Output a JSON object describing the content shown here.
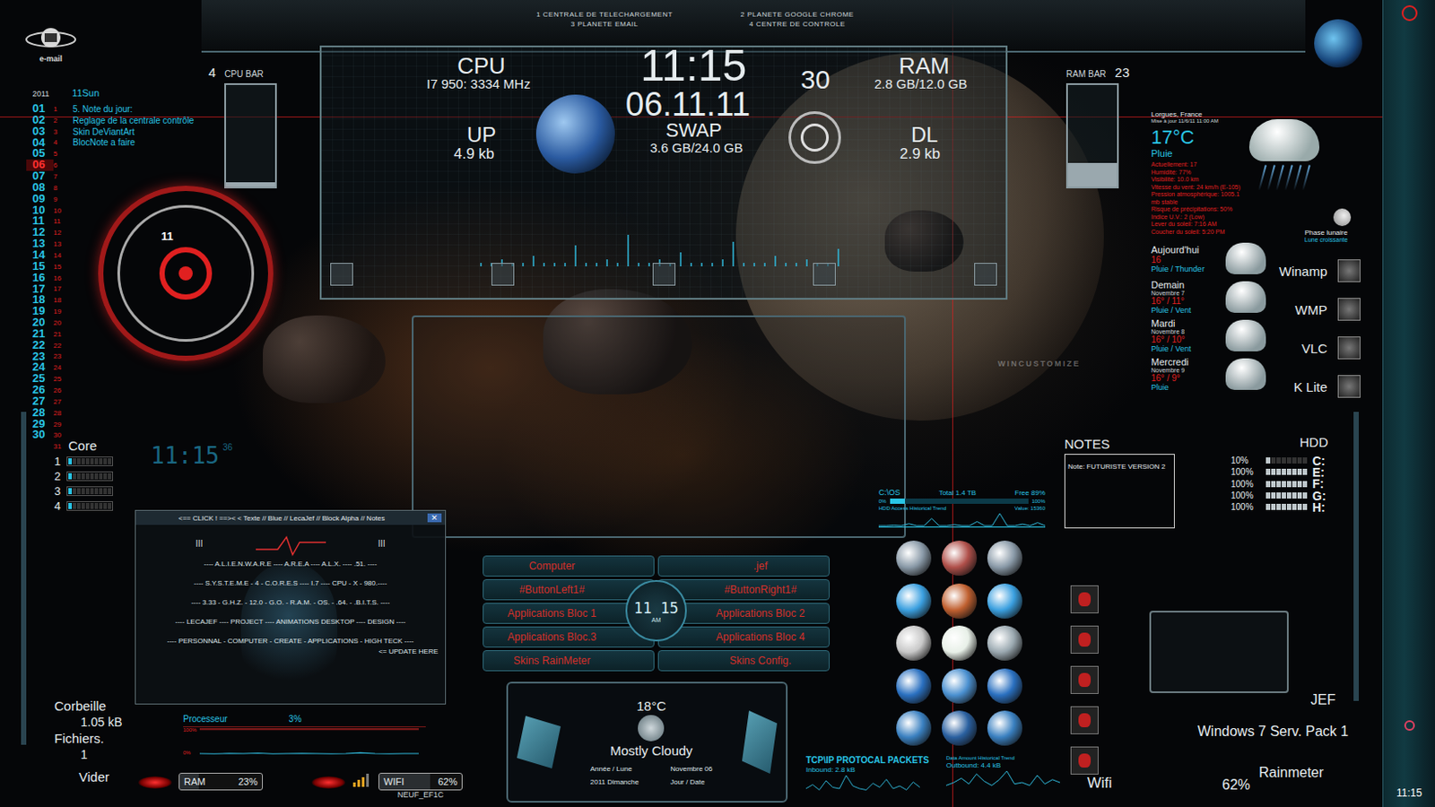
{
  "top_menu": [
    "1 CENTRALE DE TELECHARGEMENT",
    "2 PLANETE GOOGLE CHROME",
    "3 PLANETE EMAIL",
    "4 CENTRE DE CONTROLE"
  ],
  "email_logo": "e-mail",
  "hud": {
    "cpu_label": "CPU",
    "cpu_info": "I7 950: 3334 MHz",
    "time": "11:15",
    "seconds": "30",
    "date": "06.11.11",
    "ram_label": "RAM",
    "ram_info": "2.8 GB/12.0 GB",
    "up_label": "UP",
    "up_value": "4.9 kb",
    "swap_label": "SWAP",
    "swap_value": "3.6 GB/24.0 GB",
    "dl_label": "DL",
    "dl_value": "2.9 kb",
    "traffic_series": [
      1,
      1,
      2,
      1,
      1,
      3,
      1,
      1,
      1,
      6,
      1,
      1,
      2,
      1,
      9,
      1,
      1,
      2,
      1,
      4,
      1,
      1,
      1,
      2,
      7,
      1,
      1,
      1,
      3,
      1,
      1,
      2,
      1,
      1,
      5,
      1
    ]
  },
  "cpu_bar": {
    "label": "CPU BAR",
    "value": "4",
    "level": 0.04
  },
  "ram_bar": {
    "label": "RAM BAR",
    "value": "23",
    "level": 0.23
  },
  "calendar": {
    "year": "2011",
    "today": "11Sun",
    "days": [
      {
        "day": "01",
        "selected": false
      },
      {
        "day": "02",
        "selected": false
      },
      {
        "day": "03",
        "selected": false
      },
      {
        "day": "04",
        "selected": false
      },
      {
        "day": "05",
        "selected": false
      },
      {
        "day": "06",
        "selected": true
      },
      {
        "day": "07",
        "selected": false
      },
      {
        "day": "08",
        "selected": false
      },
      {
        "day": "09",
        "selected": false
      },
      {
        "day": "10",
        "selected": false
      },
      {
        "day": "11",
        "selected": false
      },
      {
        "day": "12",
        "selected": false
      },
      {
        "day": "13",
        "selected": false
      },
      {
        "day": "14",
        "selected": false
      },
      {
        "day": "15",
        "selected": false
      },
      {
        "day": "16",
        "selected": false
      },
      {
        "day": "17",
        "selected": false
      },
      {
        "day": "18",
        "selected": false
      },
      {
        "day": "19",
        "selected": false
      },
      {
        "day": "20",
        "selected": false
      },
      {
        "day": "21",
        "selected": false
      },
      {
        "day": "22",
        "selected": false
      },
      {
        "day": "23",
        "selected": false
      },
      {
        "day": "24",
        "selected": false
      },
      {
        "day": "25",
        "selected": false
      },
      {
        "day": "26",
        "selected": false
      },
      {
        "day": "27",
        "selected": false
      },
      {
        "day": "28",
        "selected": false
      },
      {
        "day": "29",
        "selected": false
      },
      {
        "day": "30",
        "selected": false
      }
    ],
    "lines": [
      "1",
      "2",
      "3",
      "4",
      "5",
      "6",
      "7",
      "8",
      "9",
      "10",
      "11",
      "12",
      "13",
      "14",
      "15",
      "16",
      "17",
      "18",
      "19",
      "20",
      "21",
      "22",
      "23",
      "24",
      "25",
      "26",
      "27",
      "28",
      "29",
      "30",
      "31"
    ]
  },
  "note": {
    "title": "5. Note du jour:",
    "items": [
      "Reglage de la centrale contrôle",
      "Skin DeViantArt",
      "BlocNote a faire"
    ]
  },
  "ring_label": "11",
  "cores": {
    "title": "Core",
    "items": [
      {
        "label": "1",
        "level": 0.05
      },
      {
        "label": "2",
        "level": 0.05
      },
      {
        "label": "3",
        "level": 0.05
      },
      {
        "label": "4",
        "level": 0.05
      }
    ]
  },
  "digital_clock": {
    "time": "11:15",
    "seconds": "36"
  },
  "notes_window": {
    "header": "<== CLICK ! ==>< < Texte // Blue // LecaJef // Block Alpha // Notes",
    "close": "✕",
    "left": "III",
    "right": "III",
    "lines": [
      "---- A.L.I.E.N.W.A.R.E ---- A.R.E.A ---- A.L.X. ---- .51. ----",
      "---- S.Y.S.T.E.M.E - 4 - C.O.R.E.S ---- I.7 ---- CPU - X - 980.----",
      "---- 3.33 - G.H.Z. - 12.0 - G.O. - R.A.M. - OS. - .64. - .B.I.T.S. ----",
      "---- LECAJEF ---- PROJECT ---- ANIMATIONS DESKTOP ---- DESIGN ----",
      "---- PERSONNAL - COMPUTER - CREATE - APPLICATIONS - HIGH TECK ----"
    ],
    "update": "<= UPDATE HERE"
  },
  "recycle": {
    "title": "Corbeille",
    "size": "1.05 kB",
    "files_label": "Fichiers.",
    "files": "1",
    "empty": "Vider"
  },
  "processor": {
    "label": "Processeur",
    "value": "3%",
    "max": "100%",
    "min": "0%",
    "series": [
      3,
      2,
      4,
      3,
      5,
      2,
      3,
      4,
      3,
      2,
      3,
      6,
      3,
      2,
      3,
      3
    ]
  },
  "ram_pill": {
    "label": "RAM",
    "value": "23%",
    "level": 0.23
  },
  "wifi_pill": {
    "label": "WIFI",
    "value": "62%",
    "level": 0.62,
    "ssid": "NEUF_EF1C"
  },
  "launcher": {
    "buttons": [
      "Computer",
      ".jef",
      "#ButtonLeft1#",
      "#ButtonRight1#",
      "Applications Bloc 1",
      "Applications Bloc 2",
      "Applications Bloc.3",
      "Applications Bloc 4",
      "Skins RainMeter",
      "Skins Config."
    ],
    "time": "11 15",
    "ampm": "AM"
  },
  "weather_small": {
    "temp": "18°C",
    "condition": "Mostly Cloudy",
    "year_moon": "Année / Lune",
    "month_day": "Novembre 06",
    "year_day": "2011 Dimanche",
    "day_date": "Jour / Date"
  },
  "disk": {
    "drive": "C:\\OS",
    "total": "Total 1.4 TB",
    "free": "Free 89%",
    "min": "0%",
    "max": "100%",
    "level": 0.11,
    "trend_label": "HDD Access Historical Trend",
    "value": "Value: 15360",
    "series": [
      0,
      0,
      2,
      0,
      10,
      0,
      0,
      35,
      0,
      0,
      5,
      0,
      0,
      20,
      0,
      0,
      60,
      0,
      0,
      8,
      0,
      15,
      0
    ]
  },
  "network": {
    "title": "TCP\\IP PROTOCAL PACKETS",
    "inbound": "Inbound: 2.8 kB",
    "trend_label": "Data Amount Historical Trend",
    "outbound": "Outbound: 4.4 kB",
    "in_series": [
      2,
      5,
      1,
      8,
      3,
      2,
      12,
      4,
      2,
      1,
      6,
      3,
      9,
      2,
      4,
      1,
      7,
      3
    ],
    "out_series": [
      1,
      3,
      6,
      2,
      9,
      4,
      1,
      5,
      11,
      2,
      3,
      1,
      8,
      2,
      5,
      3
    ]
  },
  "weather": {
    "location": "Lorgues, France",
    "updated": "Mise à jour 11/6/11 11:00 AM",
    "temp": "17°C",
    "condition": "Pluie",
    "details": [
      "Actuellement: 17",
      "Humidité: 77%",
      "Visibilité: 10.0 km",
      "Vitesse du vent: 24 km/h (E-105)",
      "Pression atmosphérique: 1005.1 mb stable",
      "Risque de précipitations: 50%",
      "Indice U.V.: 2 (Low)",
      "Lever du soleil: 7:16 AM",
      "Coucher du soleil: 5:20 PM"
    ],
    "moon_label": "Phase lunaire",
    "moon_phase": "Lune croissante",
    "forecast": [
      {
        "day": "Aujourd'hui",
        "temp": "16",
        "condition": "Pluie / Thunder"
      },
      {
        "day": "Demain",
        "date": "Novembre 7",
        "temp": "16° / 11°",
        "condition": "Pluie / Vent"
      },
      {
        "day": "Mardi",
        "date": "Novembre 8",
        "temp": "16° / 10°",
        "condition": "Pluie / Vent"
      },
      {
        "day": "Mercredi",
        "date": "Novembre 9",
        "temp": "16° / 9°",
        "condition": "Pluie"
      }
    ]
  },
  "media": [
    "Winamp",
    "WMP",
    "VLC",
    "K Lite"
  ],
  "notes_widget": {
    "title": "NOTES",
    "text": "Note: FUTURISTE VERSION 2"
  },
  "hdd": {
    "title": "HDD",
    "drives": [
      {
        "letter": "C:",
        "value": "10%",
        "level": 0.1
      },
      {
        "letter": "E:",
        "value": "100%",
        "level": 1
      },
      {
        "letter": "F:",
        "value": "100%",
        "level": 1
      },
      {
        "letter": "G:",
        "value": "100%",
        "level": 1
      },
      {
        "letter": "H:",
        "value": "100%",
        "level": 1
      }
    ]
  },
  "watermark": "WINCUSTOMIZE",
  "system": {
    "user": "JEF",
    "os": "Windows 7 Serv. Pack 1",
    "app": "Rainmeter",
    "wifi_label": "Wifi",
    "wifi_value": "62%"
  },
  "taskbar": {
    "time": "11:15"
  }
}
